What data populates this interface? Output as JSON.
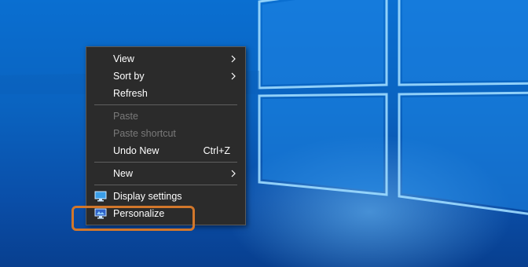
{
  "menu": {
    "view": "View",
    "sort_by": "Sort by",
    "refresh": "Refresh",
    "paste": "Paste",
    "paste_shortcut": "Paste shortcut",
    "undo_new": "Undo New",
    "undo_new_shortcut": "Ctrl+Z",
    "new": "New",
    "display_settings": "Display settings",
    "personalize": "Personalize"
  },
  "icons": {
    "submenu": "chevron-right-icon",
    "display_settings": "monitor-icon",
    "personalize": "personalize-monitor-icon"
  },
  "colors": {
    "desktop": "#0a63c0",
    "menu_bg": "#2b2b2b",
    "highlight": "#d2772b"
  }
}
